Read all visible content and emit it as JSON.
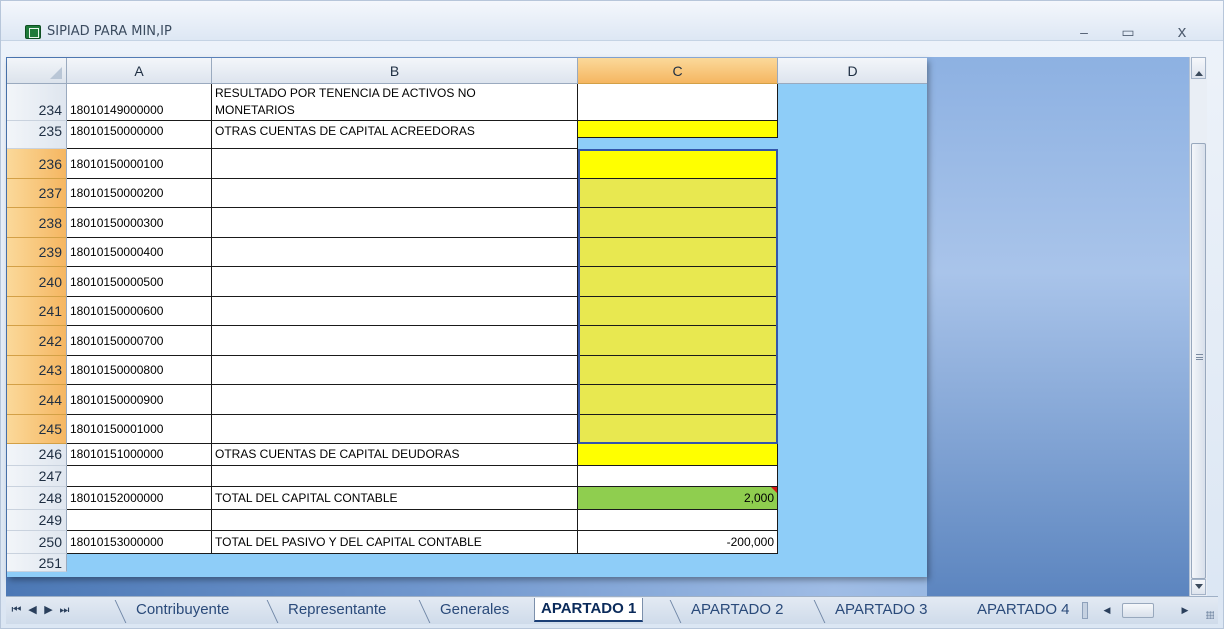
{
  "window": {
    "title": "SIPIAD PARA MIN,IP",
    "minimize": "–",
    "maximize": "▭",
    "close": "x"
  },
  "columns": [
    "A",
    "B",
    "C",
    "D"
  ],
  "selected_column": "C",
  "rows": [
    {
      "num": "234",
      "a": "18010149000000",
      "b1": "RESULTADO POR TENENCIA DE ACTIVOS NO",
      "b2": "MONETARIOS",
      "c": ""
    },
    {
      "num": "235",
      "a": "18010150000000",
      "b": "OTRAS CUENTAS DE CAPITAL ACREEDORAS",
      "c": ""
    },
    {
      "num": "236",
      "a": "18010150000100",
      "b": "",
      "c": ""
    },
    {
      "num": "237",
      "a": "18010150000200",
      "b": "",
      "c": ""
    },
    {
      "num": "238",
      "a": "18010150000300",
      "b": "",
      "c": ""
    },
    {
      "num": "239",
      "a": "18010150000400",
      "b": "",
      "c": ""
    },
    {
      "num": "240",
      "a": "18010150000500",
      "b": "",
      "c": ""
    },
    {
      "num": "241",
      "a": "18010150000600",
      "b": "",
      "c": ""
    },
    {
      "num": "242",
      "a": "18010150000700",
      "b": "",
      "c": ""
    },
    {
      "num": "243",
      "a": "18010150000800",
      "b": "",
      "c": ""
    },
    {
      "num": "244",
      "a": "18010150000900",
      "b": "",
      "c": ""
    },
    {
      "num": "245",
      "a": "18010150001000",
      "b": "",
      "c": ""
    },
    {
      "num": "246",
      "a": "18010151000000",
      "b": "OTRAS CUENTAS DE CAPITAL DEUDORAS",
      "c": ""
    },
    {
      "num": "247",
      "a": "",
      "b": "",
      "c": ""
    },
    {
      "num": "248",
      "a": "18010152000000",
      "b": "TOTAL DEL CAPITAL CONTABLE",
      "c": "2,000"
    },
    {
      "num": "249",
      "a": "",
      "b": "",
      "c": ""
    },
    {
      "num": "250",
      "a": "18010153000000",
      "b": "TOTAL DEL PASIVO Y DEL CAPITAL CONTABLE",
      "c": "-200,000"
    },
    {
      "num": "251"
    }
  ],
  "colors": {
    "yellow": "#ffff00",
    "selected_yellow": "#e8e850",
    "green": "#8fce4f",
    "sheet_background": "#8ecdf8"
  },
  "tabs": {
    "nav": [
      "⏮",
      "◀",
      "▶",
      "⏭"
    ],
    "items": [
      "Contribuyente",
      "Representante",
      "Generales",
      "APARTADO 1",
      "APARTADO 2",
      "APARTADO 3",
      "APARTADO 4"
    ],
    "active": "APARTADO 1"
  }
}
